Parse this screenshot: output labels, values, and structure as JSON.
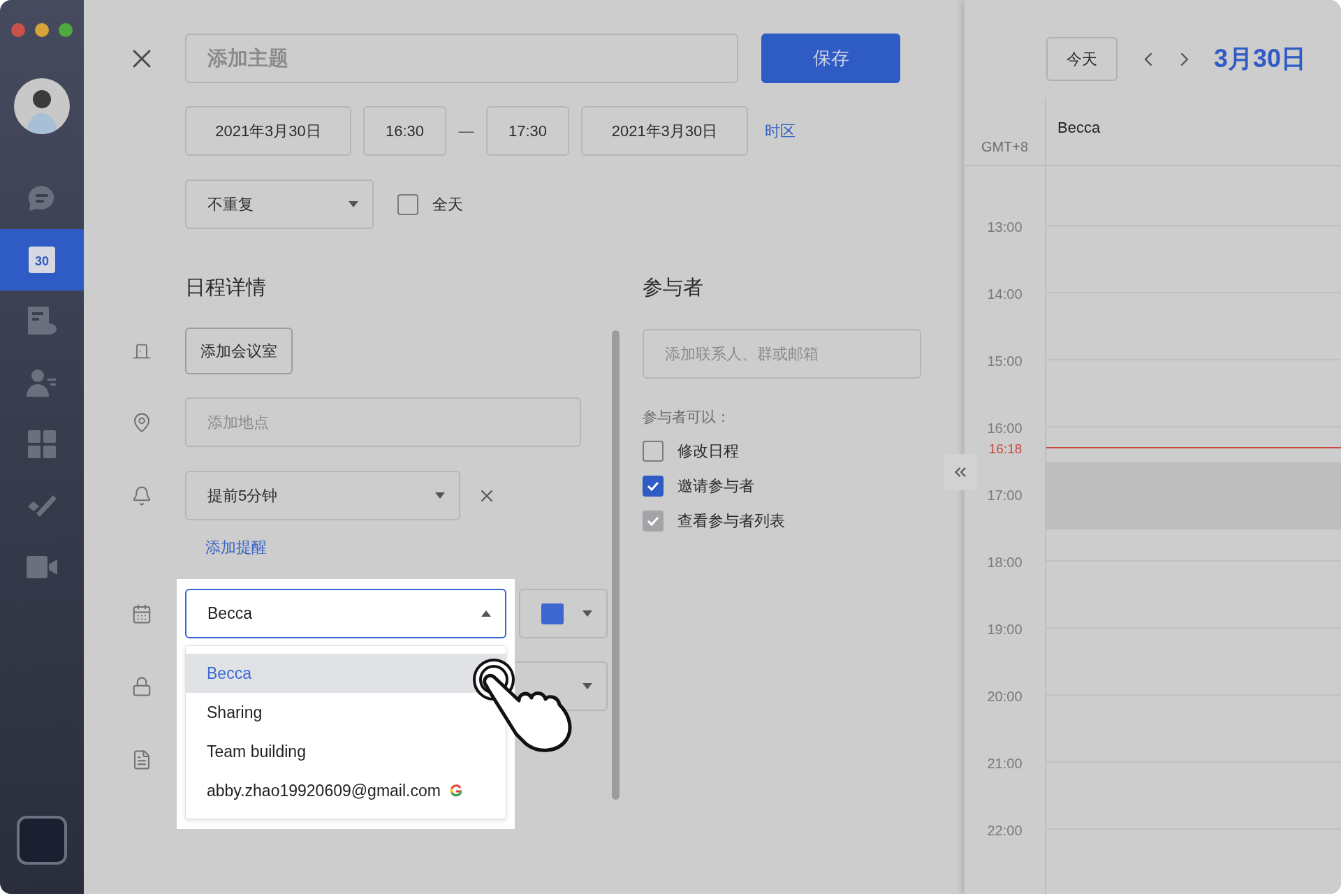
{
  "window": {
    "traffic_lights": [
      {
        "color": "#c9534a"
      },
      {
        "color": "#d6a23a"
      },
      {
        "color": "#4faa3e"
      }
    ]
  },
  "sidebar": {
    "items": [
      {
        "kind": "chat",
        "selected": false
      },
      {
        "kind": "calendar",
        "label": "30",
        "selected": true
      },
      {
        "kind": "docs",
        "selected": false
      },
      {
        "kind": "contacts",
        "selected": false
      },
      {
        "kind": "apps",
        "selected": false
      },
      {
        "kind": "tasks",
        "selected": false
      },
      {
        "kind": "video",
        "selected": false
      }
    ]
  },
  "event_form": {
    "title": {
      "placeholder": "添加主题"
    },
    "save_button": "保存",
    "start_date": "2021年3月30日",
    "start_time": "16:30",
    "separator": "—",
    "end_time": "17:30",
    "end_date": "2021年3月30日",
    "timezone_link": "时区",
    "repeat": {
      "value": "不重复"
    },
    "all_day": {
      "label": "全天",
      "checked": false
    },
    "details": {
      "heading": "日程详情",
      "room_button": "添加会议室",
      "location": {
        "placeholder": "添加地点"
      },
      "reminder": {
        "value": "提前5分钟"
      },
      "add_reminder_link": "添加提醒",
      "calendar_select": {
        "value": "Becca",
        "expanded": true,
        "options": [
          {
            "label": "Becca",
            "selected": true,
            "google": false
          },
          {
            "label": "Sharing",
            "selected": false,
            "google": false
          },
          {
            "label": "Team building",
            "selected": false,
            "google": false
          },
          {
            "label": "abby.zhao19920609@gmail.com",
            "selected": false,
            "google": true
          }
        ]
      }
    },
    "participants": {
      "heading": "参与者",
      "field": {
        "placeholder": "添加联系人、群或邮箱"
      },
      "permissions_label": "参与者可以：",
      "permissions": [
        {
          "label": "修改日程",
          "checked": false,
          "disabled": false
        },
        {
          "label": "邀请参与者",
          "checked": true,
          "disabled": false
        },
        {
          "label": "查看参与者列表",
          "checked": true,
          "disabled": true
        }
      ]
    }
  },
  "calendar_panel": {
    "today_button": "今天",
    "date_title": "3月30日",
    "timezone": "GMT+8",
    "column": "Becca",
    "hours": [
      "13:00",
      "14:00",
      "15:00",
      "16:00",
      "17:00",
      "18:00",
      "19:00",
      "20:00",
      "21:00",
      "22:00"
    ],
    "now": "16:18"
  }
}
